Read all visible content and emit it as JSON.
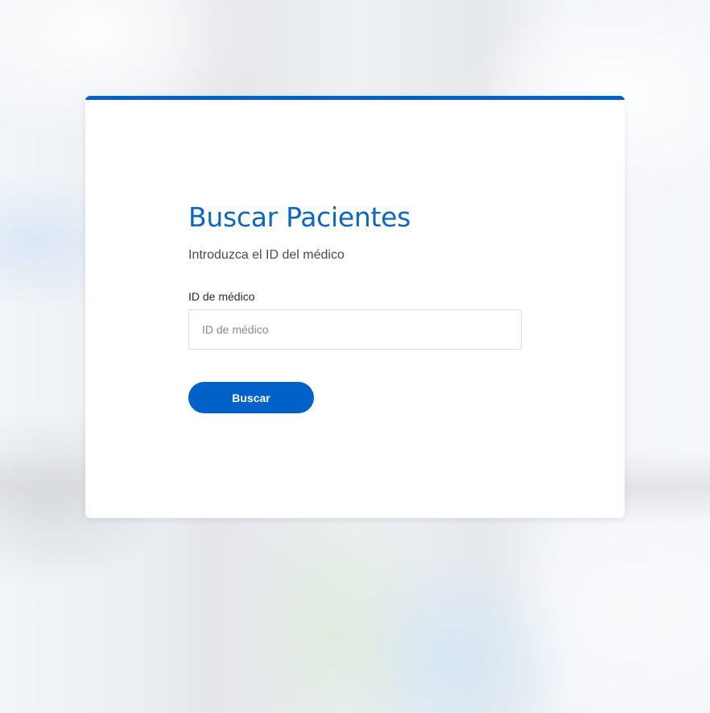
{
  "colors": {
    "accent": "#0062c8",
    "title": "#0b67c2"
  },
  "form": {
    "title": "Buscar Pacientes",
    "subtitle": "Introduzca el ID del médico",
    "doctor_id_label": "ID de médico",
    "doctor_id_placeholder": "ID de médico",
    "doctor_id_value": "",
    "search_button_label": "Buscar"
  }
}
